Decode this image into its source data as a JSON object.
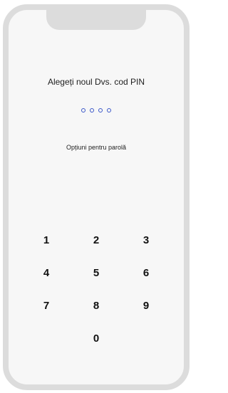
{
  "pin_setup": {
    "title": "Alegeți noul Dvs. cod PIN",
    "pin_length": 4,
    "options_link": "Opțiuni pentru parolă"
  },
  "keypad": {
    "keys": [
      "1",
      "2",
      "3",
      "4",
      "5",
      "6",
      "7",
      "8",
      "9",
      "0"
    ]
  },
  "colors": {
    "pin_dot_outline": "#3a57c8",
    "frame": "#dcdcdc",
    "screen_background": "#f7f7f7"
  }
}
